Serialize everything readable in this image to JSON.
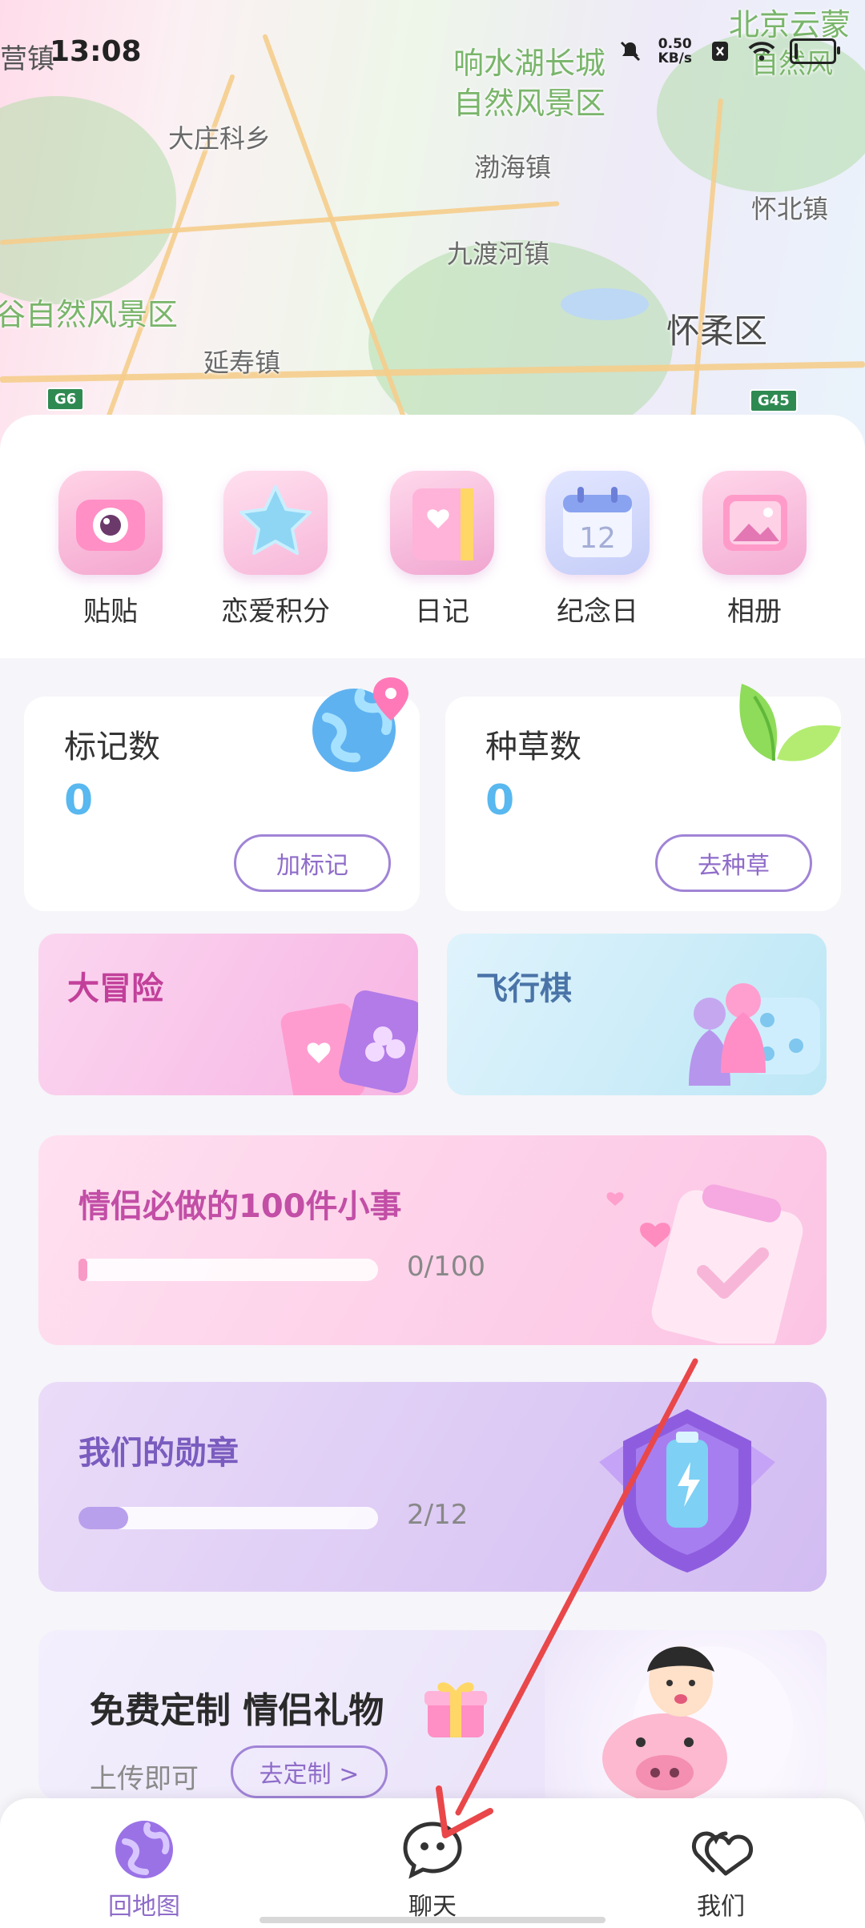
{
  "status_bar": {
    "clock": "13:08",
    "map_fragment": "营镇",
    "net_speed_value": "0.50",
    "net_speed_unit": "KB/s"
  },
  "map": {
    "labels": [
      "北京云蒙",
      "响水湖长城",
      "自然风景区",
      "大庄科乡",
      "渤海镇",
      "怀北镇",
      "九渡河镇",
      "谷自然风景区",
      "怀柔区",
      "延寿镇",
      "自然风"
    ],
    "shields": [
      "G6",
      "G45"
    ]
  },
  "quick_actions": [
    {
      "label": "贴贴",
      "icon": "camera-icon"
    },
    {
      "label": "恋爱积分",
      "icon": "star-icon"
    },
    {
      "label": "日记",
      "icon": "diary-icon"
    },
    {
      "label": "纪念日",
      "icon": "calendar-icon"
    },
    {
      "label": "相册",
      "icon": "photo-album-icon"
    }
  ],
  "calendar_day": "12",
  "stats": {
    "marks": {
      "title": "标记数",
      "value": "0",
      "button": "加标记"
    },
    "plants": {
      "title": "种草数",
      "value": "0",
      "button": "去种草"
    }
  },
  "games": {
    "adventure": "大冒险",
    "ludo": "飞行棋"
  },
  "things_100": {
    "title": "情侣必做的100件小事",
    "progress_text": "0/100",
    "progress_fraction": 0.0
  },
  "medals": {
    "title": "我们的勋章",
    "progress_text": "2/12",
    "progress_fraction": 0.1667
  },
  "gift": {
    "title": "免费定制 情侣礼物",
    "subtitle": "上传即可",
    "button": "去定制 >"
  },
  "tabbar": [
    {
      "label": "回地图",
      "icon": "globe-icon",
      "active": true
    },
    {
      "label": "聊天",
      "icon": "chat-icon",
      "active": false
    },
    {
      "label": "我们",
      "icon": "hearts-icon",
      "active": false
    }
  ],
  "colors": {
    "accent_purple": "#8f6cc9",
    "stat_value_blue": "#58b8ef",
    "adventure_title": "#c2409a",
    "ludo_title": "#4a74a8",
    "things_title": "#c24ea6",
    "medal_title": "#7a5cbf",
    "annotation_arrow": "#e9474a"
  }
}
